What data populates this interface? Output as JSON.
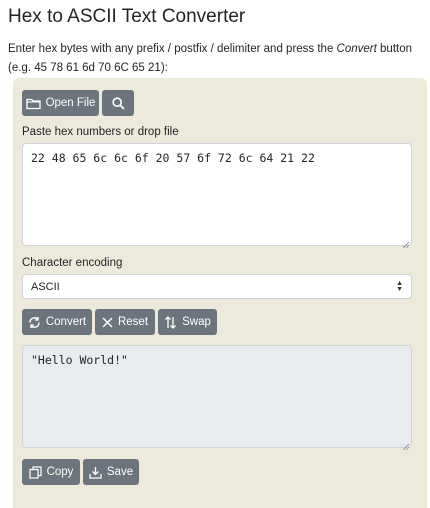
{
  "title": "Hex to ASCII Text Converter",
  "intro": {
    "line1_before": "Enter hex bytes with any prefix / postfix / delimiter and press the ",
    "line1_emph": "Convert",
    "line1_after": " button",
    "line2": "(e.g. 45 78 61 6d 70 6C 65 21):"
  },
  "toolbar": {
    "open_file_label": "Open File",
    "open_icon": "folder-icon",
    "search_icon": "search-icon"
  },
  "input": {
    "label": "Paste hex numbers or drop file",
    "value": "22 48 65 6c 6c 6f 20 57 6f 72 6c 64 21 22"
  },
  "encoding": {
    "label": "Character encoding",
    "selected": "ASCII"
  },
  "actions": {
    "convert_label": "Convert",
    "reset_label": "Reset",
    "swap_label": "Swap"
  },
  "output": {
    "value": "\"Hello World!\""
  },
  "bottom": {
    "copy_label": "Copy",
    "save_label": "Save"
  },
  "colors": {
    "panel": "#eeeadb",
    "button": "#6c757d",
    "output_bg": "#e9ecef"
  }
}
